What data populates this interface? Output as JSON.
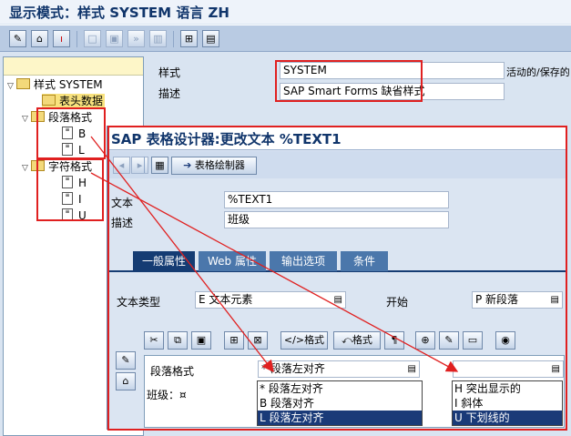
{
  "window_title": "显示模式：样式 SYSTEM 语言 ZH",
  "tree": {
    "root": "样式 SYSTEM",
    "header_data": "表头数据",
    "paragraph_formats": "段落格式",
    "paragraph_items": [
      "B",
      "L"
    ],
    "char_formats": "字符格式",
    "char_items": [
      "H",
      "I",
      "U"
    ]
  },
  "style_panel": {
    "style_label": "样式",
    "style_value": "SYSTEM",
    "desc_label": "描述",
    "desc_value": "SAP Smart Forms 缺省样式",
    "status_text": "活动的/保存的"
  },
  "popup": {
    "title": "SAP 表格设计器:更改文本 %TEXT1",
    "form_painter_label": "表格绘制器",
    "text_label": "文本",
    "text_value": "%TEXT1",
    "desc_label": "描述",
    "desc_value": "班级",
    "tabs": [
      "一般属性",
      "Web 属性",
      "输出选项",
      "条件"
    ],
    "text_type_label": "文本类型",
    "text_type_value": "E 文本元素",
    "start_label": "开始",
    "start_value": "P 新段落",
    "format_btn1": "格式",
    "format_btn2": "格式",
    "para_format_label": "段落格式",
    "para_format_value": "* 段落左对齐",
    "para_options": [
      "* 段落左对齐",
      "B 段落对齐",
      "L 段落左对齐"
    ],
    "char_options": [
      "H 突出显示的",
      "I 斜体",
      "U 下划线的"
    ],
    "editor_text": "班级：¤"
  }
}
